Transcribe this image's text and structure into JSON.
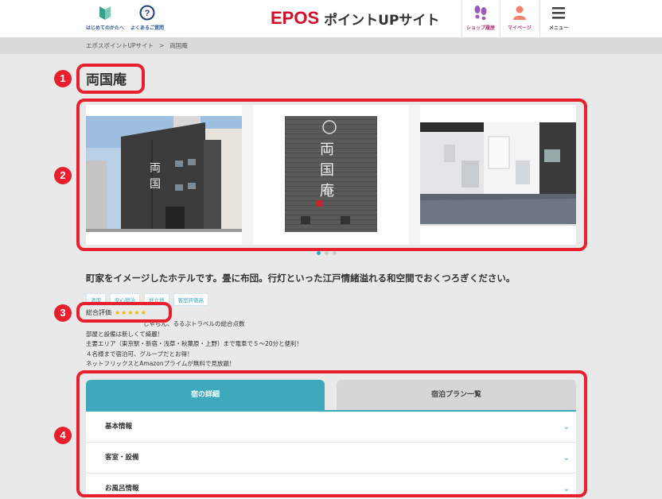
{
  "header": {
    "nav_beginner": "はじめてのかたへ",
    "nav_faq": "よくあるご質問",
    "logo_brand": "EPOS",
    "logo_site": "ポイントUPサイト",
    "nav_shop": "ショップ履歴",
    "nav_mypage": "マイページ",
    "nav_menu": "メニュー",
    "brand_color": "#d40d28"
  },
  "breadcrumb": {
    "home": "エポスポイントUPサイト",
    "separator": ">",
    "current": "両国庵"
  },
  "page": {
    "title": "両国庵",
    "description": "町家をイメージしたホテルです。畳に布団。行灯といった江戸情緒溢れる和空間でおくつろぎください。",
    "tags": [
      "清潔",
      "安心宿泊",
      "好立地",
      "客室評価高"
    ],
    "rating_label": "総合評価",
    "rating_stars": "★★★★★",
    "info_lines": [
      "じゃらん、るるぶトラベルの総合点数",
      "部屋と設備は新しくて綺麗！",
      "主要エリア（東京駅・新宿・浅草・秋葉原・上野）まで電車で５～20分と便利！",
      "４名様まで宿泊可、グループだとお得！",
      "ネットフリックスとAmazonプライムが無料で見放題！"
    ]
  },
  "gallery": {
    "slides": [
      "hotel-exterior-photo",
      "hotel-sign-photo",
      "hotel-room-photo"
    ],
    "active_dot": 0
  },
  "tabs": {
    "details": "宿の詳細",
    "plans": "宿泊プラン一覧"
  },
  "accordion": [
    "基本情報",
    "客室・設備",
    "お風呂情報"
  ],
  "annotations": [
    "1",
    "2",
    "3",
    "4"
  ],
  "accent_color": "#3ea9bd",
  "annotation_color": "#e8202e"
}
